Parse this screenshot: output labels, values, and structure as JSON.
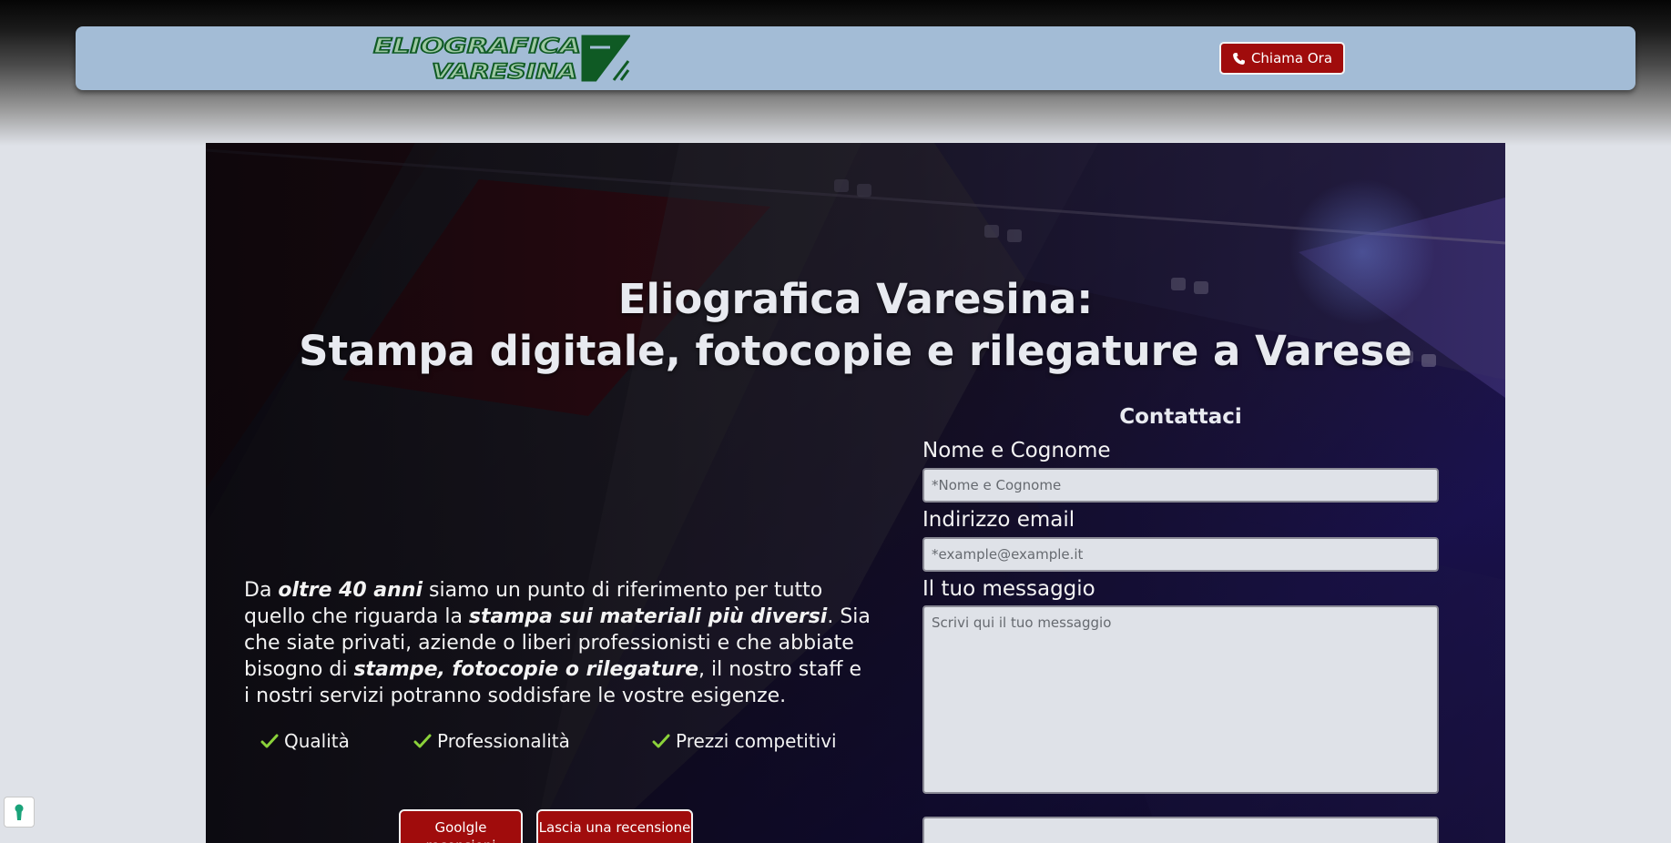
{
  "header": {
    "logo_alt": "Eliografica Varesina",
    "logo_line1": "ELIOGRAFICA",
    "logo_line2": "VARESINA",
    "call_label": "Chiama Ora"
  },
  "hero": {
    "title_line1": "Eliografica Varesina:",
    "title_line2": "Stampa digitale, fotocopie e rilegature a Varese",
    "intro": {
      "t1": "Da ",
      "e1": "oltre 40 anni",
      "t2": " siamo un punto di riferimento per tutto quello che riguarda la ",
      "e2": "stampa sui materiali più diversi",
      "t3": ". Sia che siate privati, aziende o liberi professionisti e che abbiate bisogno di ",
      "e3": "stampe, fotocopie o rilegature",
      "t4": ", il nostro staff e i nostri servizi potranno soddisfare le vostre esigenze."
    },
    "features": [
      "Qualità",
      "Professionalità",
      "Prezzi competitivi"
    ],
    "buttons": {
      "reviews_label": "Goolgle recensioni",
      "leave_review_label": "Lascia una recensione"
    }
  },
  "contact_form": {
    "title": "Contattaci",
    "name_label": "Nome e Cognome",
    "name_placeholder": "*Nome e Cognome",
    "email_label": "Indirizzo email",
    "email_placeholder": "*example@example.it",
    "message_label": "Il tuo messaggio",
    "message_placeholder": "Scrivi qui il tuo messaggio"
  },
  "colors": {
    "navbar": "#a3bcd6",
    "accent_button": "#a00c0c",
    "logo_green": "#0f5a24",
    "check_green": "#8bd23a",
    "page_background": "#dfe2e8"
  }
}
